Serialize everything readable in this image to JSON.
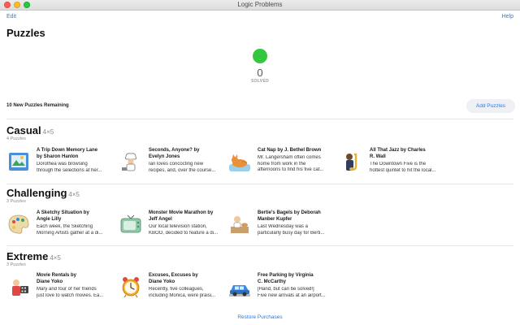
{
  "window": {
    "title": "Logic Problems"
  },
  "toolbar": {
    "edit_label": "Edit",
    "help_label": "Help"
  },
  "page": {
    "title": "Puzzles"
  },
  "solved": {
    "count": "0",
    "label": "SOLVED",
    "color": "#35c63f"
  },
  "remaining": {
    "text": "10 New Puzzles Remaining",
    "add_label": "Add Puzzles"
  },
  "sections": [
    {
      "title": "Casual",
      "size": "4×5",
      "count": "4 Puzzles",
      "puzzles": [
        {
          "title1": "A Trip Down Memory Lane",
          "title2": "by Sharon Hanlon",
          "desc1": "Dorothea was browsing",
          "desc2": "through the selections at her...",
          "icon": "photo-album-icon"
        },
        {
          "title1": "Seconds, Anyone? by",
          "title2": "Evelyn Jones",
          "desc1": "Ian loves concocting new",
          "desc2": "recipes, and, over the course...",
          "icon": "chef-icon"
        },
        {
          "title1": "Cat Nap by J. Bethel Brown",
          "title2": "",
          "desc1": "Mr. Langersham often comes",
          "desc2": "home from work in the",
          "desc3": "afternoons to find his five cat...",
          "icon": "cat-icon"
        },
        {
          "title1": "All That Jazz by Charles",
          "title2": "R. Wall",
          "desc1": "The Downtown Five is the",
          "desc2": "hottest quintet to hit the local...",
          "icon": "saxophone-icon"
        }
      ]
    },
    {
      "title": "Challenging",
      "size": "4×5",
      "count": "3 Puzzles",
      "puzzles": [
        {
          "title1": "A Sketchy Situation by",
          "title2": "Angie Lilly",
          "desc1": "Each week, the Sketching",
          "desc2": "Morning Artists gather at a di...",
          "icon": "palette-icon"
        },
        {
          "title1": "Monster Movie Marathon by",
          "title2": "Jeff Angel",
          "desc1": "Our local television station,",
          "desc2": "KBOO, decided to feature a di...",
          "icon": "television-icon"
        },
        {
          "title1": "Bertie's Bagels by Deborah",
          "title2": "Manber Kupfer",
          "desc1": "Last Wednesday was a",
          "desc2": "particularly busy day for Berti...",
          "icon": "bagel-shop-icon"
        }
      ]
    },
    {
      "title": "Extreme",
      "size": "4×5",
      "count": "3 Puzzles",
      "puzzles": [
        {
          "title1": "Movie Rentals by",
          "title2": "Diane Yoko",
          "desc1": "Mary and four of her friends",
          "desc2": "just love to watch movies. Ea...",
          "icon": "film-reel-icon"
        },
        {
          "title1": "Excuses, Excuses by",
          "title2": "Diane Yoko",
          "desc1": "Recently, five colleagues,",
          "desc2": "including Monica, were praisi...",
          "icon": "alarm-clock-icon"
        },
        {
          "title1": "Free Parking by Virginia",
          "title2": "C. McCarthy",
          "desc1": "[Hand, but can be solved!]",
          "desc2": "Five new arrivals at an airport...",
          "icon": "car-icon"
        }
      ]
    }
  ],
  "footer": {
    "restore_label": "Restore Purchases"
  }
}
